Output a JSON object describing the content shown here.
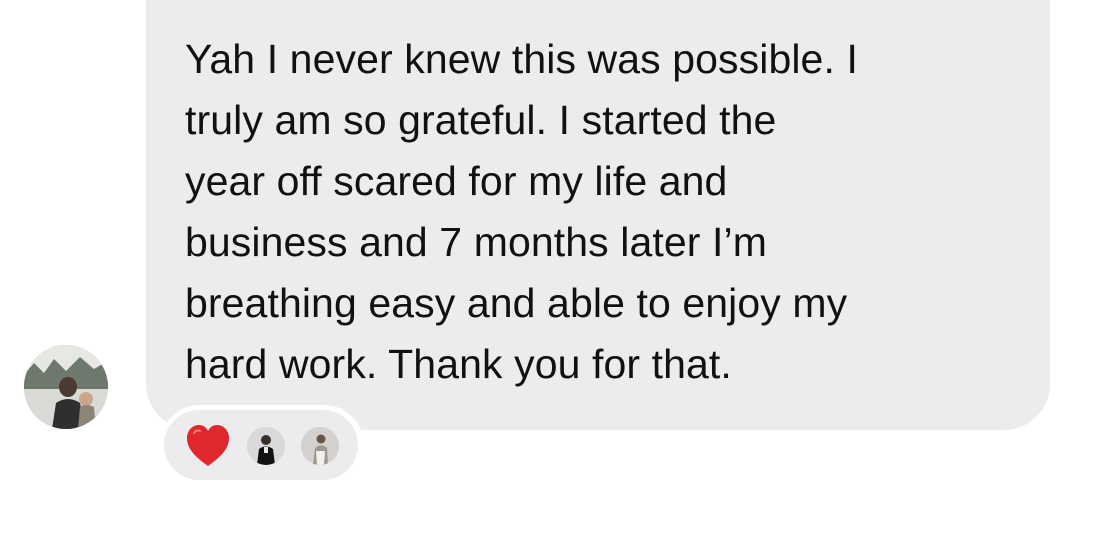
{
  "message": {
    "text": "Yah I never knew this was possible. I\ntruly am so grateful. I started the\nyear off scared for my life and\nbusiness and 7 months later I’m\nbreathing easy and able to enjoy my\nhard work. Thank you for that."
  },
  "reactions": {
    "items": [
      "heart-emoji",
      "reactor-avatar",
      "reactor-avatar"
    ]
  },
  "colors": {
    "bubble": "#ececee",
    "text": "#111111",
    "heart": "#e0282e"
  }
}
